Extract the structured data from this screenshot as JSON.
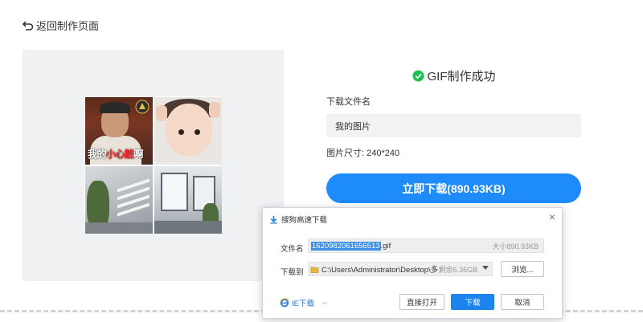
{
  "header": {
    "back_label": "返回制作页面"
  },
  "preview": {
    "caption_prefix": "我的",
    "caption_highlight": "小心脏",
    "caption_suffix": "啊"
  },
  "result": {
    "success_text": "GIF制作成功",
    "filename_label": "下载文件名",
    "filename_value": "我的图片",
    "size_text": "图片尺寸: 240*240",
    "download_label": "立即下载(890.93KB)",
    "accent_color": "#1d8cfa",
    "success_color": "#1fbf4f"
  },
  "dialog": {
    "title": "搜狗高速下载",
    "close_symbol": "×",
    "name_label": "文件名",
    "name_selected": "1620982061656513",
    "name_ext": ".gif",
    "size_text": "大小890.93KB",
    "save_to_label": "下载到",
    "path_text": "C:\\Users\\Administrator\\Desktop\\多",
    "free_space": "剩余6.36GB",
    "browse_label": "浏览...",
    "ie_label": "IE下载",
    "ie_chevron": "⌵",
    "open_label": "直接打开",
    "download_label": "下载",
    "cancel_label": "取消"
  }
}
